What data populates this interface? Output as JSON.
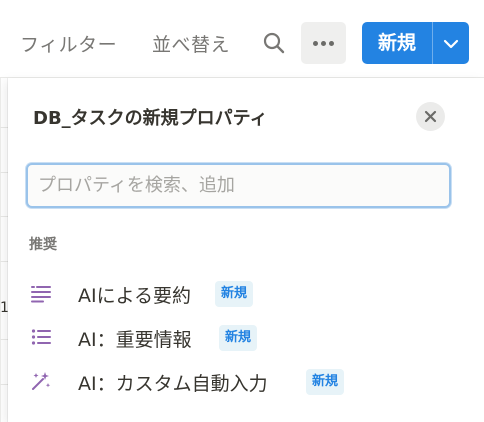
{
  "toolbar": {
    "filter_label": "フィルター",
    "sort_label": "並べ替え",
    "new_label": "新規"
  },
  "background": {
    "row_fragment": "1"
  },
  "panel": {
    "title": "DB_タスクの新規プロパティ",
    "search_placeholder": "プロパティを検索、追加",
    "section_label": "推奨",
    "items": [
      {
        "label": "AIによる要約",
        "badge": "新規",
        "icon": "ai-summary-icon"
      },
      {
        "label": "AI：重要情報",
        "badge": "新規",
        "icon": "ai-key-info-list-icon"
      },
      {
        "label": "AI：カスタム自動入力",
        "badge": "新規",
        "icon": "ai-sparkle-icon"
      }
    ]
  },
  "colors": {
    "accent": "#2383e2",
    "ai_icon": "#9065b0",
    "badge_bg": "#e7f3f8",
    "muted_text": "#787774"
  }
}
